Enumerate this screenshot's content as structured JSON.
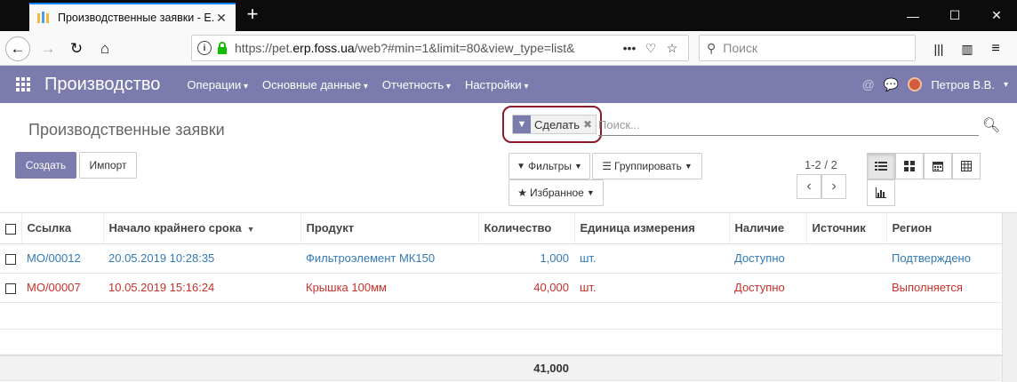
{
  "browser": {
    "tab_title": "Производственные заявки - Е...",
    "url_prefix": "https://pet.",
    "url_domain": "erp.foss.ua",
    "url_suffix": "/web?#min=1&limit=80&view_type=list&",
    "search_placeholder": "Поиск"
  },
  "app": {
    "brand": "Производство",
    "menu": [
      "Операции",
      "Основные данные",
      "Отчетность",
      "Настройки"
    ],
    "user": "Петров В.В.",
    "accent_color": "#7c7bad"
  },
  "control_panel": {
    "breadcrumb": "Производственные заявки",
    "create_label": "Создать",
    "import_label": "Импорт",
    "facet_value": "Сделать",
    "search_placeholder": "Поиск...",
    "filters_label": "Фильтры",
    "group_label": "Группировать",
    "favorites_label": "Избранное",
    "pager": "1-2 / 2"
  },
  "table": {
    "columns": [
      "Ссылка",
      "Начало крайнего срока",
      "Продукт",
      "Количество",
      "Единица измерения",
      "Наличие",
      "Источник",
      "Регион"
    ],
    "rows": [
      {
        "ref": "МО/00012",
        "date": "20.05.2019 10:28:35",
        "product": "Фильтроэлемент МК150",
        "qty": "1,000",
        "uom": "шт.",
        "availability": "Доступно",
        "source": "",
        "state": "Подтверждено",
        "color": "#337ab7"
      },
      {
        "ref": "МО/00007",
        "date": "10.05.2019 15:16:24",
        "product": "Крышка 100мм",
        "qty": "40,000",
        "uom": "шт.",
        "availability": "Доступно",
        "source": "",
        "state": "Выполняется",
        "color": "#c9302c"
      }
    ],
    "total_qty": "41,000"
  }
}
